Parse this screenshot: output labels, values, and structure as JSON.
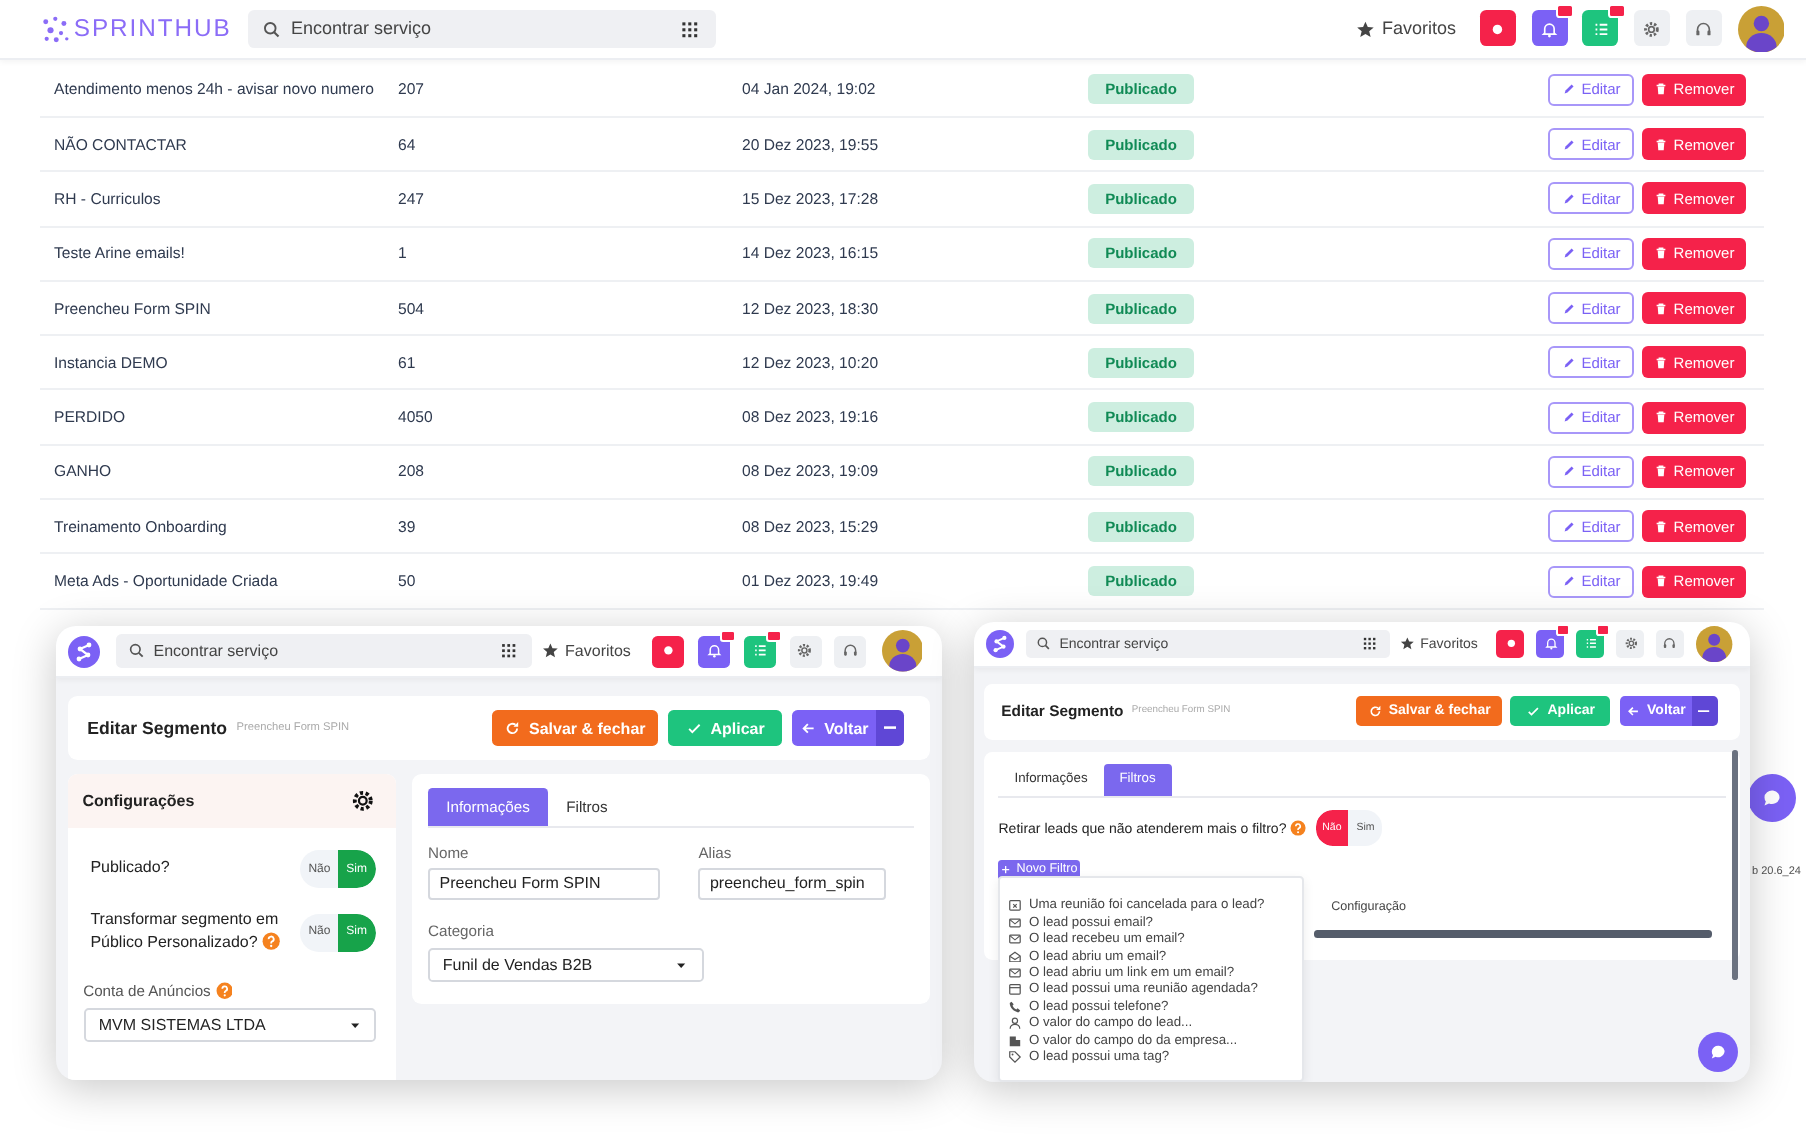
{
  "header": {
    "logo": "SPRINTHUB",
    "search": {
      "placeholder": "Encontrar serviço"
    },
    "favorites": "Favoritos"
  },
  "table": {
    "rows": [
      {
        "name": "Atendimento menos 24h - avisar novo numero",
        "count": "207",
        "date": "04 Jan 2024, 19:02",
        "status": "Publicado",
        "edit": "Editar",
        "remove": "Remover"
      },
      {
        "name": "NÃO CONTACTAR",
        "count": "64",
        "date": "20 Dez 2023, 19:55",
        "status": "Publicado",
        "edit": "Editar",
        "remove": "Remover"
      },
      {
        "name": "RH - Curriculos",
        "count": "247",
        "date": "15 Dez 2023, 17:28",
        "status": "Publicado",
        "edit": "Editar",
        "remove": "Remover"
      },
      {
        "name": "Teste Arine emails!",
        "count": "1",
        "date": "14 Dez 2023, 16:15",
        "status": "Publicado",
        "edit": "Editar",
        "remove": "Remover"
      },
      {
        "name": "Preencheu Form SPIN",
        "count": "504",
        "date": "12 Dez 2023, 18:30",
        "status": "Publicado",
        "edit": "Editar",
        "remove": "Remover"
      },
      {
        "name": "Instancia DEMO",
        "count": "61",
        "date": "12 Dez 2023, 10:20",
        "status": "Publicado",
        "edit": "Editar",
        "remove": "Remover"
      },
      {
        "name": "PERDIDO",
        "count": "4050",
        "date": "08 Dez 2023, 19:16",
        "status": "Publicado",
        "edit": "Editar",
        "remove": "Remover"
      },
      {
        "name": "GANHO",
        "count": "208",
        "date": "08 Dez 2023, 19:09",
        "status": "Publicado",
        "edit": "Editar",
        "remove": "Remover"
      },
      {
        "name": "Treinamento Onboarding",
        "count": "39",
        "date": "08 Dez 2023, 15:29",
        "status": "Publicado",
        "edit": "Editar",
        "remove": "Remover"
      },
      {
        "name": "Meta Ads - Oportunidade Criada",
        "count": "50",
        "date": "01 Dez 2023, 19:49",
        "status": "Publicado",
        "edit": "Editar",
        "remove": "Remover"
      }
    ]
  },
  "version": "b 20.6_24",
  "windows": [
    {
      "kind": "informacoes",
      "header": {
        "search": {
          "placeholder": "Encontrar serviço"
        },
        "favorites": "Favoritos"
      },
      "title": "Editar Segmento",
      "subtitle": "Preencheu Form SPIN",
      "buttons": [
        {
          "kind": "save",
          "label": "Salvar & fechar"
        },
        {
          "kind": "apply",
          "label": "Aplicar"
        },
        {
          "kind": "back",
          "label": "Voltar"
        }
      ],
      "tabs": [
        {
          "label": "Informações",
          "selected": true
        },
        {
          "label": "Filtros",
          "selected": false
        }
      ],
      "settings": {
        "title": "Configurações",
        "toggles": [
          {
            "label": "Publicado?",
            "help": false,
            "options": [
              {
                "kind": "no",
                "label": "Não",
                "selected": false
              },
              {
                "kind": "yes",
                "label": "Sim",
                "selected": true
              }
            ]
          },
          {
            "label": "Transformar segmento em Público Personalizado?",
            "help": true,
            "options": [
              {
                "kind": "no",
                "label": "Não",
                "selected": false
              },
              {
                "kind": "yes",
                "label": "Sim",
                "selected": true
              }
            ]
          }
        ],
        "account": {
          "label": "Conta de Anúncios",
          "value": "MVM SISTEMAS LTDA"
        }
      },
      "fields": [
        {
          "label": "Nome",
          "value": "Preencheu Form SPIN"
        },
        {
          "label": "Alias",
          "value": "preencheu_form_spin"
        }
      ],
      "category": {
        "label": "Categoria",
        "value": "Funil de Vendas B2B"
      }
    },
    {
      "kind": "filtros",
      "header": {
        "search": {
          "placeholder": "Encontrar serviço"
        },
        "favorites": "Favoritos"
      },
      "title": "Editar Segmento",
      "subtitle": "Preencheu Form SPIN",
      "buttons": [
        {
          "kind": "save",
          "label": "Salvar & fechar"
        },
        {
          "kind": "apply",
          "label": "Aplicar"
        },
        {
          "kind": "back",
          "label": "Voltar"
        }
      ],
      "tabs": [
        {
          "label": "Informações",
          "selected": false
        },
        {
          "label": "Filtros",
          "selected": true
        }
      ],
      "question": {
        "label": "Retirar leads que não atenderem mais o filtro?",
        "help": true,
        "options": [
          {
            "kind": "no",
            "label": "Não",
            "selected": true
          },
          {
            "kind": "yes",
            "label": "Sim",
            "selected": false
          }
        ]
      },
      "new_filter": "Novo Filtro",
      "filter_options": [
        {
          "kind": "meeting-cancel",
          "label": "Uma reunião foi cancelada para o lead?"
        },
        {
          "kind": "email",
          "label": "O lead possui email?"
        },
        {
          "kind": "email",
          "label": "O lead recebeu um email?"
        },
        {
          "kind": "email-open",
          "label": "O lead abriu um email?"
        },
        {
          "kind": "email",
          "label": "O lead abriu um link em um email?"
        },
        {
          "kind": "meeting",
          "label": "O lead possui uma reunião agendada?"
        },
        {
          "kind": "phone",
          "label": "O lead possui telefone?"
        },
        {
          "kind": "person",
          "label": "O valor do campo do lead..."
        },
        {
          "kind": "company",
          "label": "O valor do campo do da empresa..."
        },
        {
          "kind": "tag",
          "label": "O lead possui uma tag?"
        }
      ],
      "column_label": "Configuração"
    }
  ]
}
